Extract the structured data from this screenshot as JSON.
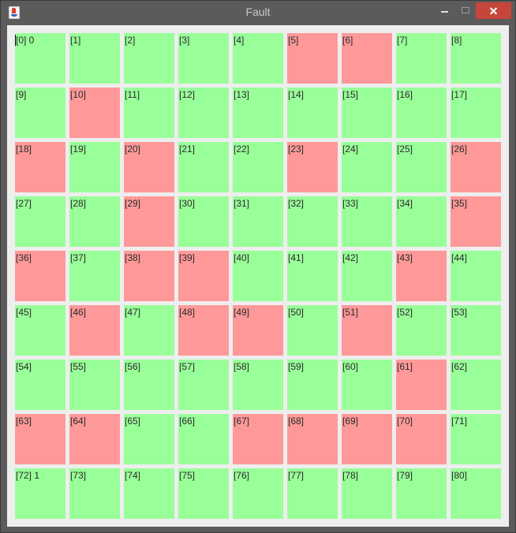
{
  "window": {
    "title": "Fault"
  },
  "colors": {
    "ok": "#99ff99",
    "fault": "#ff9999"
  },
  "icons": {
    "app": "java-app-icon",
    "minimize": "minimize-icon",
    "maximize": "maximize-icon",
    "close": "close-icon"
  },
  "cells": [
    {
      "label": "[0] 0",
      "status": "ok"
    },
    {
      "label": "[1]",
      "status": "ok"
    },
    {
      "label": "[2]",
      "status": "ok"
    },
    {
      "label": "[3]",
      "status": "ok"
    },
    {
      "label": "[4]",
      "status": "ok"
    },
    {
      "label": "[5]",
      "status": "fault"
    },
    {
      "label": "[6]",
      "status": "fault"
    },
    {
      "label": "[7]",
      "status": "ok"
    },
    {
      "label": "[8]",
      "status": "ok"
    },
    {
      "label": "[9]",
      "status": "ok"
    },
    {
      "label": "[10]",
      "status": "fault"
    },
    {
      "label": "[11]",
      "status": "ok"
    },
    {
      "label": "[12]",
      "status": "ok"
    },
    {
      "label": "[13]",
      "status": "ok"
    },
    {
      "label": "[14]",
      "status": "ok"
    },
    {
      "label": "[15]",
      "status": "ok"
    },
    {
      "label": "[16]",
      "status": "ok"
    },
    {
      "label": "[17]",
      "status": "ok"
    },
    {
      "label": "[18]",
      "status": "fault"
    },
    {
      "label": "[19]",
      "status": "ok"
    },
    {
      "label": "[20]",
      "status": "fault"
    },
    {
      "label": "[21]",
      "status": "ok"
    },
    {
      "label": "[22]",
      "status": "ok"
    },
    {
      "label": "[23]",
      "status": "fault"
    },
    {
      "label": "[24]",
      "status": "ok"
    },
    {
      "label": "[25]",
      "status": "ok"
    },
    {
      "label": "[26]",
      "status": "fault"
    },
    {
      "label": "[27]",
      "status": "ok"
    },
    {
      "label": "[28]",
      "status": "ok"
    },
    {
      "label": "[29]",
      "status": "fault"
    },
    {
      "label": "[30]",
      "status": "ok"
    },
    {
      "label": "[31]",
      "status": "ok"
    },
    {
      "label": "[32]",
      "status": "ok"
    },
    {
      "label": "[33]",
      "status": "ok"
    },
    {
      "label": "[34]",
      "status": "ok"
    },
    {
      "label": "[35]",
      "status": "fault"
    },
    {
      "label": "[36]",
      "status": "fault"
    },
    {
      "label": "[37]",
      "status": "ok"
    },
    {
      "label": "[38]",
      "status": "fault"
    },
    {
      "label": "[39]",
      "status": "fault"
    },
    {
      "label": "[40]",
      "status": "ok"
    },
    {
      "label": "[41]",
      "status": "ok"
    },
    {
      "label": "[42]",
      "status": "ok"
    },
    {
      "label": "[43]",
      "status": "fault"
    },
    {
      "label": "[44]",
      "status": "ok"
    },
    {
      "label": "[45]",
      "status": "ok"
    },
    {
      "label": "[46]",
      "status": "fault"
    },
    {
      "label": "[47]",
      "status": "ok"
    },
    {
      "label": "[48]",
      "status": "fault"
    },
    {
      "label": "[49]",
      "status": "fault"
    },
    {
      "label": "[50]",
      "status": "ok"
    },
    {
      "label": "[51]",
      "status": "fault"
    },
    {
      "label": "[52]",
      "status": "ok"
    },
    {
      "label": "[53]",
      "status": "ok"
    },
    {
      "label": "[54]",
      "status": "ok"
    },
    {
      "label": "[55]",
      "status": "ok"
    },
    {
      "label": "[56]",
      "status": "ok"
    },
    {
      "label": "[57]",
      "status": "ok"
    },
    {
      "label": "[58]",
      "status": "ok"
    },
    {
      "label": "[59]",
      "status": "ok"
    },
    {
      "label": "[60]",
      "status": "ok"
    },
    {
      "label": "[61]",
      "status": "fault"
    },
    {
      "label": "[62]",
      "status": "ok"
    },
    {
      "label": "[63]",
      "status": "fault"
    },
    {
      "label": "[64]",
      "status": "fault"
    },
    {
      "label": "[65]",
      "status": "ok"
    },
    {
      "label": "[66]",
      "status": "ok"
    },
    {
      "label": "[67]",
      "status": "fault"
    },
    {
      "label": "[68]",
      "status": "fault"
    },
    {
      "label": "[69]",
      "status": "fault"
    },
    {
      "label": "[70]",
      "status": "fault"
    },
    {
      "label": "[71]",
      "status": "ok"
    },
    {
      "label": "[72] 1",
      "status": "ok"
    },
    {
      "label": "[73]",
      "status": "ok"
    },
    {
      "label": "[74]",
      "status": "ok"
    },
    {
      "label": "[75]",
      "status": "ok"
    },
    {
      "label": "[76]",
      "status": "ok"
    },
    {
      "label": "[77]",
      "status": "ok"
    },
    {
      "label": "[78]",
      "status": "ok"
    },
    {
      "label": "[79]",
      "status": "ok"
    },
    {
      "label": "[80]",
      "status": "ok"
    }
  ]
}
